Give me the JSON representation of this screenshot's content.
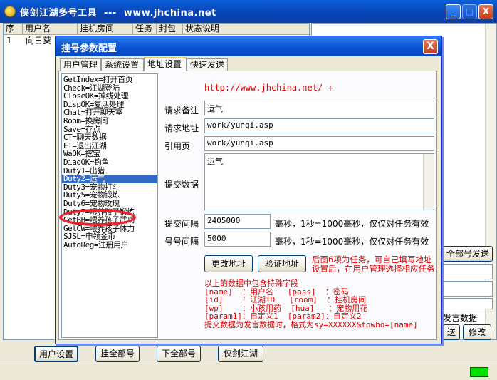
{
  "window": {
    "title": "侠剑江湖多号工具  ---  www.jhchina.net",
    "min_label": "_",
    "max_label": "□",
    "close_label": "X"
  },
  "list": {
    "columns": [
      "序",
      "用户名",
      "挂机房间",
      "任务",
      "封包",
      "状态说明"
    ],
    "rows": [
      [
        "1",
        "向日葵"
      ]
    ]
  },
  "right_controls": {
    "all_send": "全部号发送",
    "speech_data": "发言数据",
    "send_partial": "送",
    "modify": "修改"
  },
  "bottom_buttons": {
    "user_settings": "用户设置",
    "hang_all": "挂全部号",
    "unhang_all": "下全部号",
    "xiajian": "侠剑江湖"
  },
  "dialog": {
    "title": "挂号参数配置",
    "close_label": "X",
    "tabs": [
      "用户管理",
      "系统设置",
      "地址设置",
      "快速发送"
    ],
    "active_tab": 2,
    "commands": [
      "GetIndex=打开首页",
      "Check=江湖登陆",
      "CloseOK=掉线处理",
      "DispOK=复活处理",
      "Chat=打开聊天室",
      "Room=换房间",
      "Save=存点",
      "CT=聊天数据",
      "ET=退出江湖",
      "WaOK=挖宝",
      "DiaoOK=钓鱼",
      "Duty1=出猎",
      "Duty2=运气",
      "Duty3=宠物打斗",
      "Duty5=宠物锻炼",
      "Duty6=宠物玫瑰",
      "Duty7=喂养孩子锻炼",
      "GetBB=喂养孩子武功",
      "GetCW=喂养孩子体力",
      "SJSL=申领金币",
      "AutoReg=注册用户"
    ],
    "selected_command": 12,
    "site_link": "http://www.jhchina.net/  +",
    "fields": {
      "req_note_label": "请求备注",
      "req_note_value": "运气",
      "req_addr_label": "请求地址",
      "req_addr_value": "work/yunqi.asp",
      "referer_label": "引用页",
      "referer_value": "work/yunqi.asp",
      "post_label": "提交数据",
      "post_value": "运气",
      "interval_label": "提交间隔",
      "interval_value": "2405000",
      "interval_unit": "毫秒，1秒=1000毫秒，仅仅对任务有效",
      "acct_interval_label": "号号间隔",
      "acct_interval_value": "5000",
      "acct_interval_unit": "毫秒，1秒=1000毫秒，仅仅对任务有效"
    },
    "buttons": {
      "change_addr": "更改地址",
      "verify_addr": "验证地址"
    },
    "hint": "后面6项为任务，可自己填写地址\n设置后，在用户管理选择相应任务",
    "notes": "以上的数据中包含特殊字段\n[name]  ：用户名   [pass]  ：密码\n[id]    ：江湖ID   [room]  ：挂机房间\n[wp]    ：小孩用药  [hua]   ：宠物用花\n[param1]：自定义1  [param2]：自定义2\n提交数据为发言数据时，格式为sy=XXXXXX&towho=[name]"
  }
}
